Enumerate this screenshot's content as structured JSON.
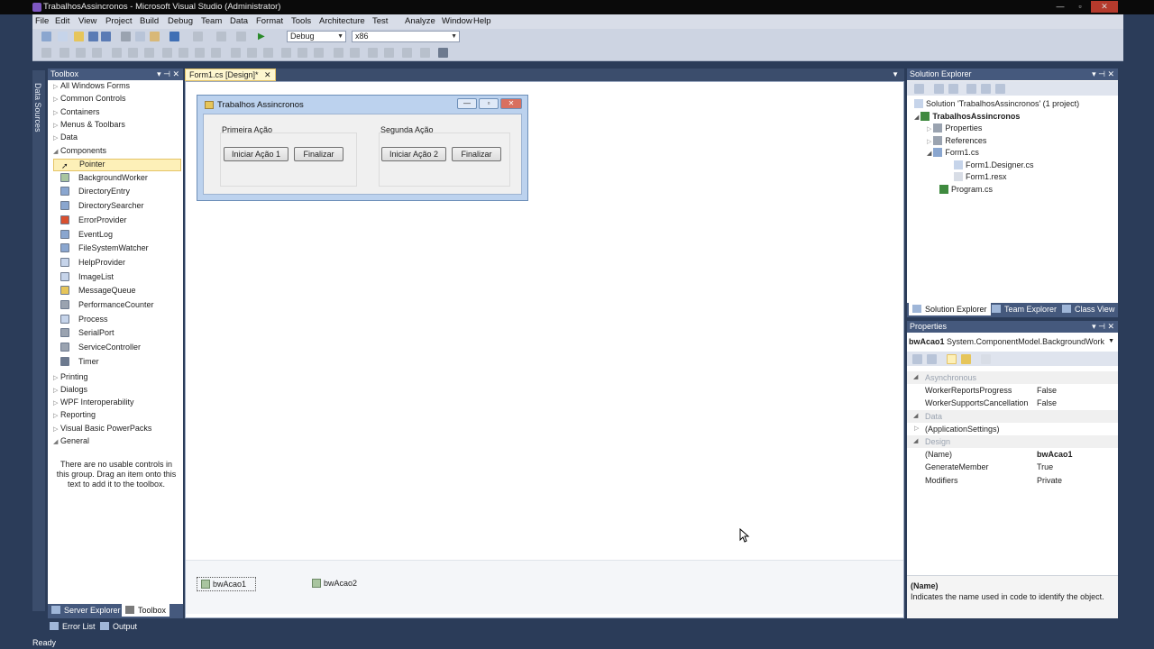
{
  "window": {
    "title": "TrabalhosAssincronos - Microsoft Visual Studio (Administrator)",
    "controls": {
      "minimize": "—",
      "maximize": "▫",
      "close": "✕"
    }
  },
  "menu": [
    "File",
    "Edit",
    "View",
    "Project",
    "Build",
    "Debug",
    "Team",
    "Data",
    "Format",
    "Tools",
    "Architecture",
    "Test",
    "Analyze",
    "Window",
    "Help"
  ],
  "toolbar": {
    "config": "Debug",
    "platform": "x86"
  },
  "left_strip": {
    "data_sources": "Data Sources"
  },
  "toolbox": {
    "title": "Toolbox",
    "groups_top": [
      "All Windows Forms",
      "Common Controls",
      "Containers",
      "Menus & Toolbars",
      "Data"
    ],
    "components_group": "Components",
    "components": [
      "Pointer",
      "BackgroundWorker",
      "DirectoryEntry",
      "DirectorySearcher",
      "ErrorProvider",
      "EventLog",
      "FileSystemWatcher",
      "HelpProvider",
      "ImageList",
      "MessageQueue",
      "PerformanceCounter",
      "Process",
      "SerialPort",
      "ServiceController",
      "Timer"
    ],
    "groups_bottom": [
      "Printing",
      "Dialogs",
      "WPF Interoperability",
      "Reporting",
      "Visual Basic PowerPacks"
    ],
    "general_group": "General",
    "empty_text": "There are no usable controls in this group. Drag an item onto this text to add it to the toolbox.",
    "bottom_tabs": {
      "server_explorer": "Server Explorer",
      "toolbox": "Toolbox"
    }
  },
  "document": {
    "tab": "Form1.cs [Design]*",
    "tab_close": "✕",
    "form": {
      "title": "Trabalhos Assincronos",
      "group1_label": "Primeira Ação",
      "group2_label": "Segunda Ação",
      "btn_start1": "Iniciar Ação 1",
      "btn_finish1": "Finalizar",
      "btn_start2": "Iniciar Ação 2",
      "btn_finish2": "Finalizar"
    },
    "tray": [
      "bwAcao1",
      "bwAcao2"
    ]
  },
  "solution_explorer": {
    "title": "Solution Explorer",
    "solution": "Solution 'TrabalhosAssincronos' (1 project)",
    "project": "TrabalhosAssincronos",
    "properties": "Properties",
    "references": "References",
    "form1": "Form1.cs",
    "form1_designer": "Form1.Designer.cs",
    "form1_resx": "Form1.resx",
    "program": "Program.cs",
    "tabs": {
      "solution": "Solution Explorer",
      "team": "Team Explorer",
      "class": "Class View"
    }
  },
  "properties": {
    "title": "Properties",
    "object": "bwAcao1",
    "object_type": "System.ComponentModel.BackgroundWork",
    "rows": [
      {
        "type": "cat",
        "name": "Asynchronous"
      },
      {
        "type": "prop",
        "name": "WorkerReportsProgress",
        "value": "False"
      },
      {
        "type": "prop",
        "name": "WorkerSupportsCancellation",
        "value": "False"
      },
      {
        "type": "cat",
        "name": "Data"
      },
      {
        "type": "prop",
        "name": "(ApplicationSettings)",
        "value": ""
      },
      {
        "type": "cat",
        "name": "Design"
      },
      {
        "type": "prop",
        "name": "(Name)",
        "value": "bwAcao1"
      },
      {
        "type": "prop",
        "name": "GenerateMember",
        "value": "True"
      },
      {
        "type": "prop",
        "name": "Modifiers",
        "value": "Private"
      }
    ],
    "desc_title": "(Name)",
    "desc_text": "Indicates the name used in code to identify the object."
  },
  "bottom_tabs": {
    "error_list": "Error List",
    "output": "Output"
  },
  "status": "Ready",
  "colors": {
    "accent": "#45597d",
    "selection": "#fdf0b8",
    "frame": "#2b3c59"
  }
}
